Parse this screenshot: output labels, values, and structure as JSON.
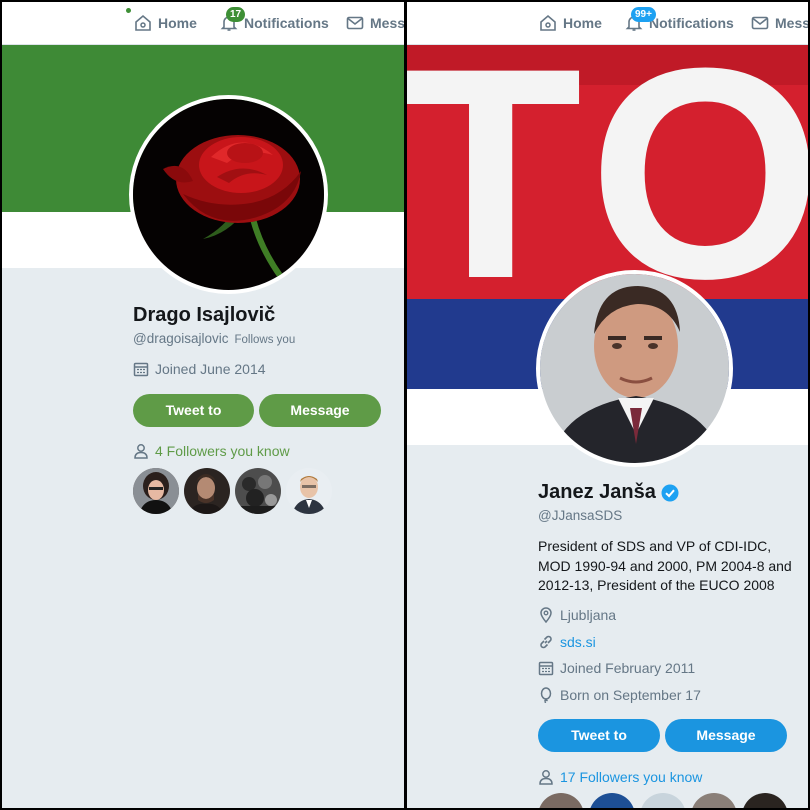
{
  "left": {
    "nav": {
      "home_label": "Home",
      "notifications_label": "Notifications",
      "notifications_badge": "17",
      "messages_label": "Messa"
    },
    "profile": {
      "name": "Drago Isajlovič",
      "handle": "@dragoisajlovic",
      "follows_you": "Follows you",
      "joined": "Joined June 2014"
    },
    "buttons": {
      "tweet_to": "Tweet to",
      "message": "Message"
    },
    "followers_you_know": "4 Followers you know",
    "colors": {
      "accent": "#5f9b47",
      "banner": "#3e8a36",
      "badge": "#3e8f36"
    }
  },
  "right": {
    "nav": {
      "home_label": "Home",
      "notifications_label": "Notifications",
      "notifications_badge": "99+",
      "messages_label": "Mess"
    },
    "banner_text": "TOP",
    "profile": {
      "name": "Janez Janša",
      "verified": true,
      "handle": "@JJansaSDS",
      "bio": "President of SDS and VP of CDI-IDC, MOD 1990-94 and 2000, PM 2004-8 and 2012-13, President of the EUCO 2008",
      "location": "Ljubljana",
      "website": "sds.si",
      "joined": "Joined February 2011",
      "birthday": "Born on September 17"
    },
    "buttons": {
      "tweet_to": "Tweet to",
      "message": "Message"
    },
    "followers_you_know": "17 Followers you know",
    "colors": {
      "accent": "#1b95e0",
      "banner_red": "#d4202e",
      "banner_blue": "#213a8e",
      "badge": "#1da1f2"
    }
  }
}
